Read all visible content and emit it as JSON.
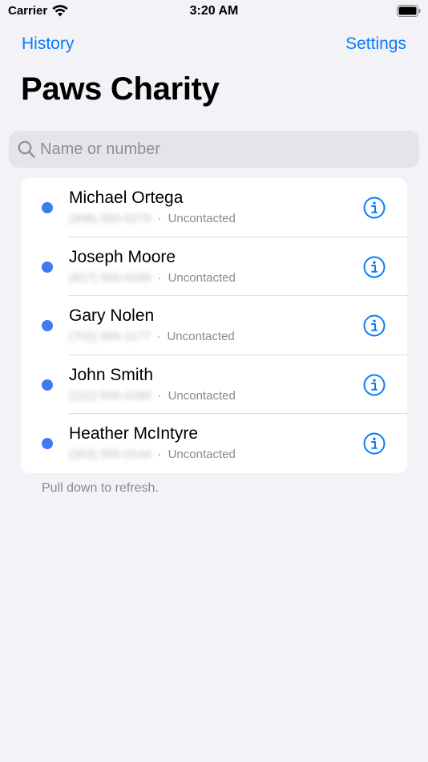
{
  "status_bar": {
    "carrier": "Carrier",
    "time": "3:20 AM"
  },
  "nav": {
    "left_label": "History",
    "right_label": "Settings"
  },
  "title": "Paws Charity",
  "search": {
    "placeholder": "Name or number",
    "value": ""
  },
  "contacts": [
    {
      "name": "Michael Ortega",
      "phone": "(408) 555-5270",
      "status": "Uncontacted"
    },
    {
      "name": "Joseph Moore",
      "phone": "(617) 555-0199",
      "status": "Uncontacted"
    },
    {
      "name": "Gary Nolen",
      "phone": "(702) 555-1177",
      "status": "Uncontacted"
    },
    {
      "name": "John Smith",
      "phone": "(212) 555-0180",
      "status": "Uncontacted"
    },
    {
      "name": "Heather McIntyre",
      "phone": "(303) 555-0144",
      "status": "Uncontacted"
    }
  ],
  "footer_hint": "Pull down to refresh.",
  "colors": {
    "accent": "#0A7AFF",
    "status_dot": "#3E7BF2",
    "background": "#F2F2F7"
  },
  "icons": {
    "search": "magnifying-glass",
    "row_action": "info-circle",
    "wifi": "wifi",
    "battery": "battery-full"
  }
}
